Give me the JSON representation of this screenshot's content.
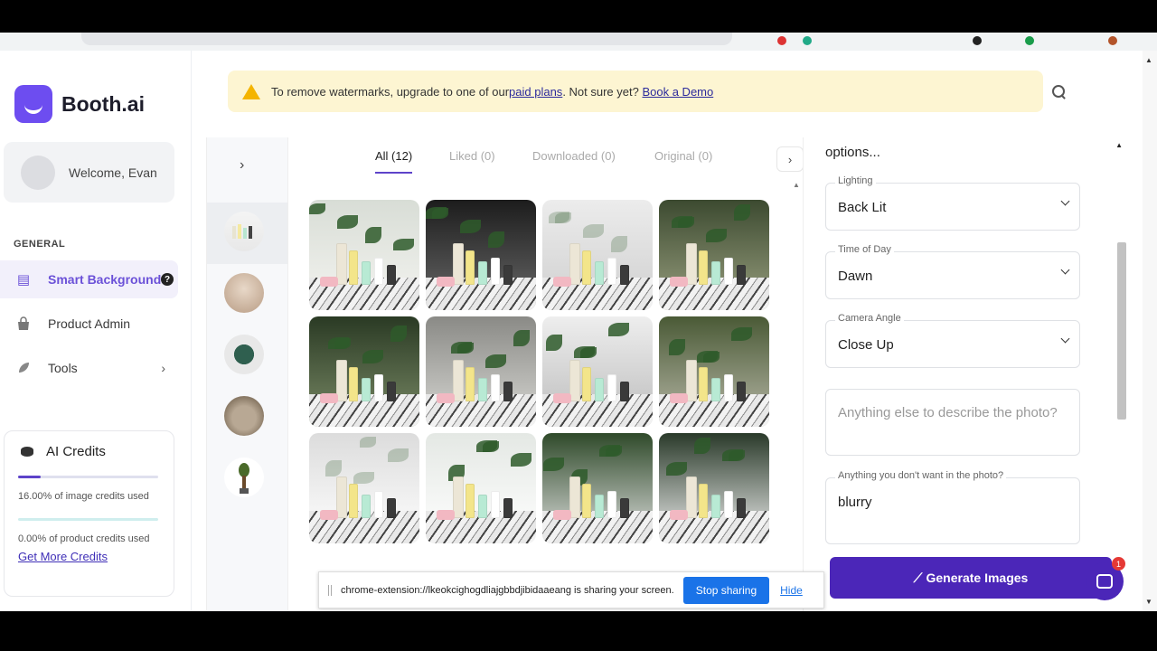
{
  "banner": {
    "prefix": "To remove watermarks, upgrade to one of our ",
    "link1": "paid plans",
    "middle": ". Not sure yet? ",
    "link2": "Book a Demo"
  },
  "sidebar": {
    "brand": "Booth.ai",
    "welcome": "Welcome, Evan",
    "section": "GENERAL",
    "items": [
      {
        "label": "Smart Backgrounds",
        "icon": "layers-icon",
        "active": true
      },
      {
        "label": "Product Admin",
        "icon": "bag-icon"
      },
      {
        "label": "Tools",
        "icon": "brush-icon"
      }
    ],
    "help_badge": "?",
    "credits": {
      "title": "AI Credits",
      "image_pct": 16,
      "image_text": "16.00% of image credits used",
      "product_pct": 0,
      "product_text": "0.00% of product credits used",
      "link": "Get More Credits"
    }
  },
  "gallery": {
    "tabs": [
      {
        "label": "All (12)",
        "active": true
      },
      {
        "label": "Liked (0)"
      },
      {
        "label": "Downloaded (0)"
      },
      {
        "label": "Original (0)"
      }
    ]
  },
  "options": {
    "heading": "options...",
    "lighting": {
      "label": "Lighting",
      "value": "Back Lit"
    },
    "time": {
      "label": "Time of Day",
      "value": "Dawn"
    },
    "camera": {
      "label": "Camera Angle",
      "value": "Close Up"
    },
    "describe": {
      "placeholder": "Anything else to describe the photo?"
    },
    "negative": {
      "label": "Anything you don't want in the photo?",
      "value": "blurry"
    },
    "generate": "Generate Images"
  },
  "chat": {
    "badge": "1"
  },
  "share_bar": {
    "message": "chrome-extension://lkeokcighogdliajgbbdjibidaaeang is sharing your screen.",
    "stop": "Stop sharing",
    "hide": "Hide"
  },
  "colors": {
    "accent": "#5d43c9",
    "button": "#4b26b8",
    "banner": "#fdf5d2"
  }
}
